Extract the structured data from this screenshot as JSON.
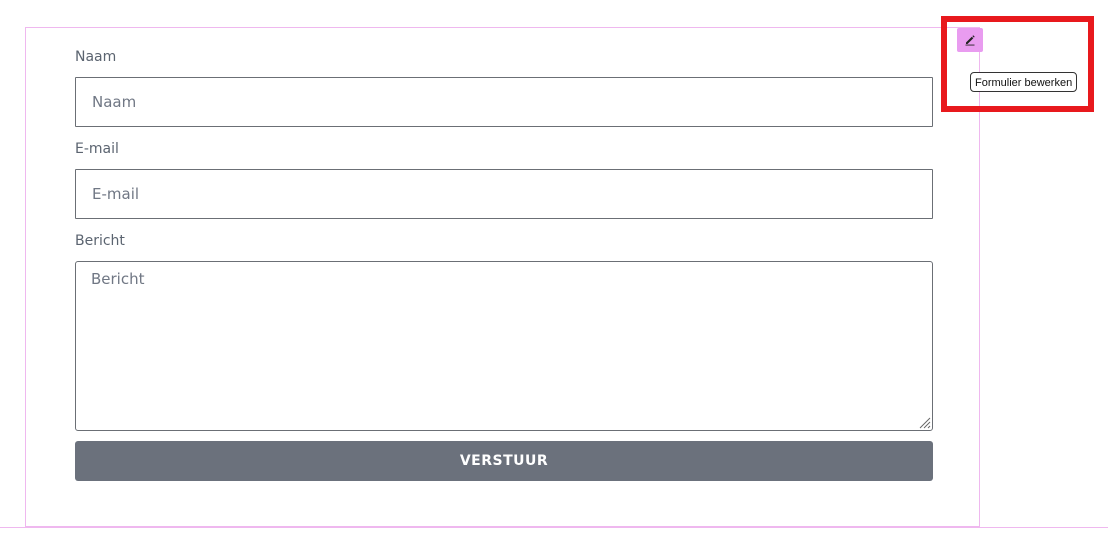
{
  "form": {
    "fields": [
      {
        "label": "Naam",
        "placeholder": "Naam"
      },
      {
        "label": "E-mail",
        "placeholder": "E-mail"
      },
      {
        "label": "Bericht",
        "placeholder": "Bericht"
      }
    ],
    "submit_label": "VERSTUUR"
  },
  "edit_widget": {
    "icon": "pencil-icon",
    "tooltip": "Formulier bewerken",
    "accent_color": "#e99cf0"
  },
  "colors": {
    "button": "#6b717c",
    "outline": "#efb8ef",
    "highlight": "#e8191d"
  }
}
